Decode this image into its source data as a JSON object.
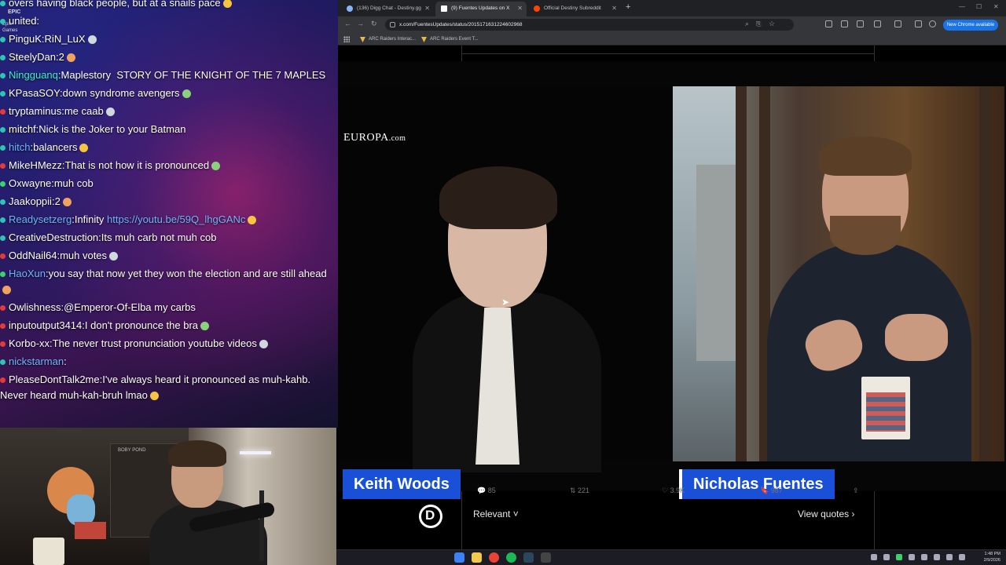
{
  "chat": {
    "corner_logo": "EPIC",
    "corner_logo_sub": "Epic Games",
    "messages": [
      {
        "badge_color": "#2ec4b6",
        "user": "",
        "text": "overs having black people, but at a snails pace"
      },
      {
        "badge_color": "#2ec4b6",
        "user": "",
        "text": "united:"
      },
      {
        "badge_color": "#2ec4b6",
        "user": "PinguK",
        "text": "RiN_LuX"
      },
      {
        "badge_color": "#2ec4b6",
        "user": "SteelyDan",
        "text": "2"
      },
      {
        "badge_color": "#2ec4b6",
        "user": "Ningguanq",
        "user_color": "#3ff0c8",
        "text": "Maplestory  STORY OF THE KNIGHT OF THE 7 MAPLES"
      },
      {
        "badge_color": "#2ec4b6",
        "user": "KPasaSOY",
        "text": "down syndrome avengers"
      },
      {
        "badge_color": "#e23b3b",
        "user": "tryptaminus",
        "text": "me caab"
      },
      {
        "badge_color": "#2ec4b6",
        "user": "mitchf",
        "text": "Nick is the Joker to your Batman"
      },
      {
        "badge_color": "#2ec4b6",
        "user": "hitch",
        "user_color": "#6fb6ff",
        "text": "balancers"
      },
      {
        "badge_color": "#e23b3b",
        "user": "MikeHMezz",
        "text": "That is not how it is pronounced"
      },
      {
        "badge_color": "#3bd16f",
        "user": "Oxwayne",
        "text": "muh cob"
      },
      {
        "badge_color": "#2ec4b6",
        "user": "Jaakoppii",
        "text": "2"
      },
      {
        "badge_color": "#2ec4b6",
        "user": "Readysetzerg",
        "user_color": "#6fb6ff",
        "text": "Infinity",
        "link": "https://youtu.be/59Q_lhgGANc"
      },
      {
        "badge_color": "#2ec4b6",
        "user": "CreativeDestruction",
        "text": "Its muh carb not muh cob"
      },
      {
        "badge_color": "#e23b3b",
        "user": "OddNail64",
        "text": "muh votes"
      },
      {
        "badge_color": "#3bd16f",
        "user": "HaoXun",
        "user_color": "#6fb6ff",
        "text": "you say that now yet they won the election and are still ahead"
      },
      {
        "badge_color": "#e23b3b",
        "user": "Owlishness",
        "text": "@Emperor-Of-Elba my carbs"
      },
      {
        "badge_color": "#e23b3b",
        "user": "inputoutput3414",
        "text": "I don't pronounce the bra"
      },
      {
        "badge_color": "#e23b3b",
        "user": "Korbo-xx",
        "text": "The never trust pronunciation youtube videos"
      },
      {
        "badge_color": "#2ec4b6",
        "user": "nickstarman",
        "user_color": "#6fb6ff",
        "text": ""
      },
      {
        "badge_color": "#e23b3b",
        "user": "PleaseDontTalk2me",
        "text": "I've always heard it pronounced as muh-kahb. Never heard muh-kah-bruh lmao"
      }
    ]
  },
  "webcam": {
    "shelf_label": "BOBY POND"
  },
  "browser": {
    "tabs": [
      {
        "label": "(136) Digg Chat - Destiny.gg",
        "fav_color": "#8ab4f8"
      },
      {
        "label": "(9) Fuentes Updates on X",
        "fav_color": "#ffffff"
      },
      {
        "label": "Official Destiny Subreddit",
        "fav_color": "#ff4500"
      }
    ],
    "new_tab": "+",
    "url": "x.com/FuentesUpdates/status/2015171631224602968",
    "new_chrome_label": "New Chrome available",
    "bookmarks": [
      {
        "label": "ARC Raiders Interac..."
      },
      {
        "label": "ARC Raiders Event T..."
      }
    ]
  },
  "post": {
    "video": {
      "watermark": "EUROPA",
      "watermark_suffix": ".com",
      "left_caption": "Keith Woods",
      "right_caption": "Nicholas Fuentes"
    },
    "actions": {
      "replies": "85",
      "reposts": "221",
      "likes": "3.9K",
      "bookmarks": "987"
    },
    "sort_label": "Relevant",
    "view_quotes": "View quotes"
  },
  "taskbar": {
    "time": "1:48 PM",
    "date": "2/9/2026"
  }
}
